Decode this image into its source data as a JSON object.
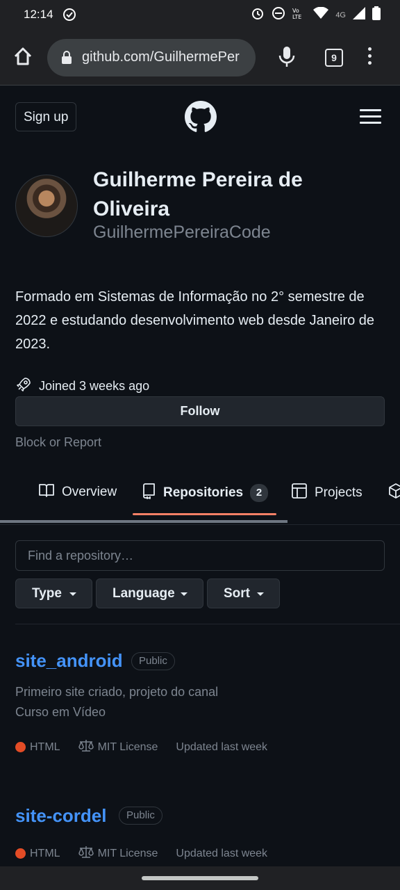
{
  "status_bar": {
    "time": "12:14",
    "network": "4G"
  },
  "browser": {
    "url": "github.com/GuilhermePer",
    "tab_count": "9"
  },
  "header": {
    "signup_label": "Sign up"
  },
  "profile": {
    "full_name": "Guilherme Pereira de Oliveira",
    "username": "GuilhermePereiraCode",
    "bio": "Formado em Sistemas de Informação no 2° semestre de 2022 e estudando desenvolvimento web desde Janeiro de 2023.",
    "joined": "Joined 3 weeks ago",
    "follow_label": "Follow",
    "block_label": "Block or Report"
  },
  "tabs": [
    {
      "label": "Overview"
    },
    {
      "label": "Repositories",
      "count": "2"
    },
    {
      "label": "Projects"
    }
  ],
  "search": {
    "placeholder": "Find a repository…"
  },
  "filters": [
    {
      "label": "Type"
    },
    {
      "label": "Language"
    },
    {
      "label": "Sort"
    }
  ],
  "repos": [
    {
      "name": "site_android",
      "visibility": "Public",
      "description": "Primeiro site criado, projeto do canal Curso em Vídeo",
      "language": "HTML",
      "language_color": "#e34c26",
      "license": "MIT License",
      "updated": "Updated last week"
    },
    {
      "name": "site-cordel",
      "visibility": "Public",
      "language": "HTML",
      "language_color": "#e34c26",
      "license": "MIT License",
      "updated": "Updated last week"
    }
  ],
  "colors": {
    "background": "#0d1117",
    "link": "#4493f8",
    "active_tab_underline": "#f78166"
  }
}
